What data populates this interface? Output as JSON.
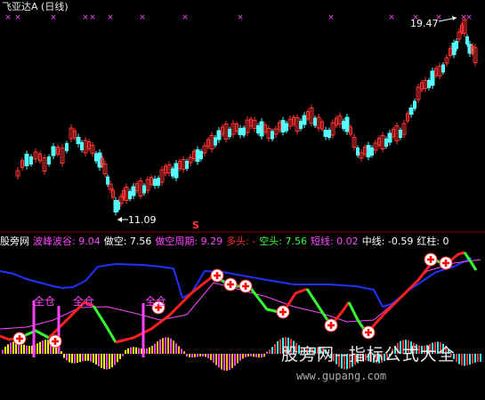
{
  "header": {
    "title": "飞亚达A (日线)"
  },
  "price_panel": {
    "high_label": "19.47",
    "low_label": "11.09",
    "s_marker": "S"
  },
  "indicator_bar": {
    "name": "股旁网",
    "items": [
      {
        "text": "波峰波谷: 9.04",
        "color": "#ff44ff"
      },
      {
        "text": "做空: 7.56",
        "color": "#ffffff"
      },
      {
        "text": "做空周期: 9.29",
        "color": "#ff44ff"
      },
      {
        "text": "多头: -",
        "color": "#ff3333"
      },
      {
        "text": "空头: 7.56",
        "color": "#33ff33"
      },
      {
        "text": "短线: 0.02",
        "color": "#ff44ff"
      },
      {
        "text": "中线: -0.59",
        "color": "#ffffff"
      },
      {
        "text": "红柱: 0",
        "color": "#ffffff"
      }
    ]
  },
  "annotations": {
    "full_position": "全仓"
  },
  "watermark": {
    "text": "股旁网--指标公式大全",
    "url": "www.gupang.com"
  },
  "chart_data": {
    "type": "candlestick",
    "price_high": 19.47,
    "price_low": 11.09,
    "colors": {
      "up": "#ff3333",
      "down": "#54fcfc",
      "bar_pos": "#ff44ff",
      "bar_neg": "#ffff00",
      "red_line": "#ff2020",
      "green_line": "#33ff33",
      "blue_line": "#2233ff",
      "mid_line": "#ff44ff"
    }
  }
}
